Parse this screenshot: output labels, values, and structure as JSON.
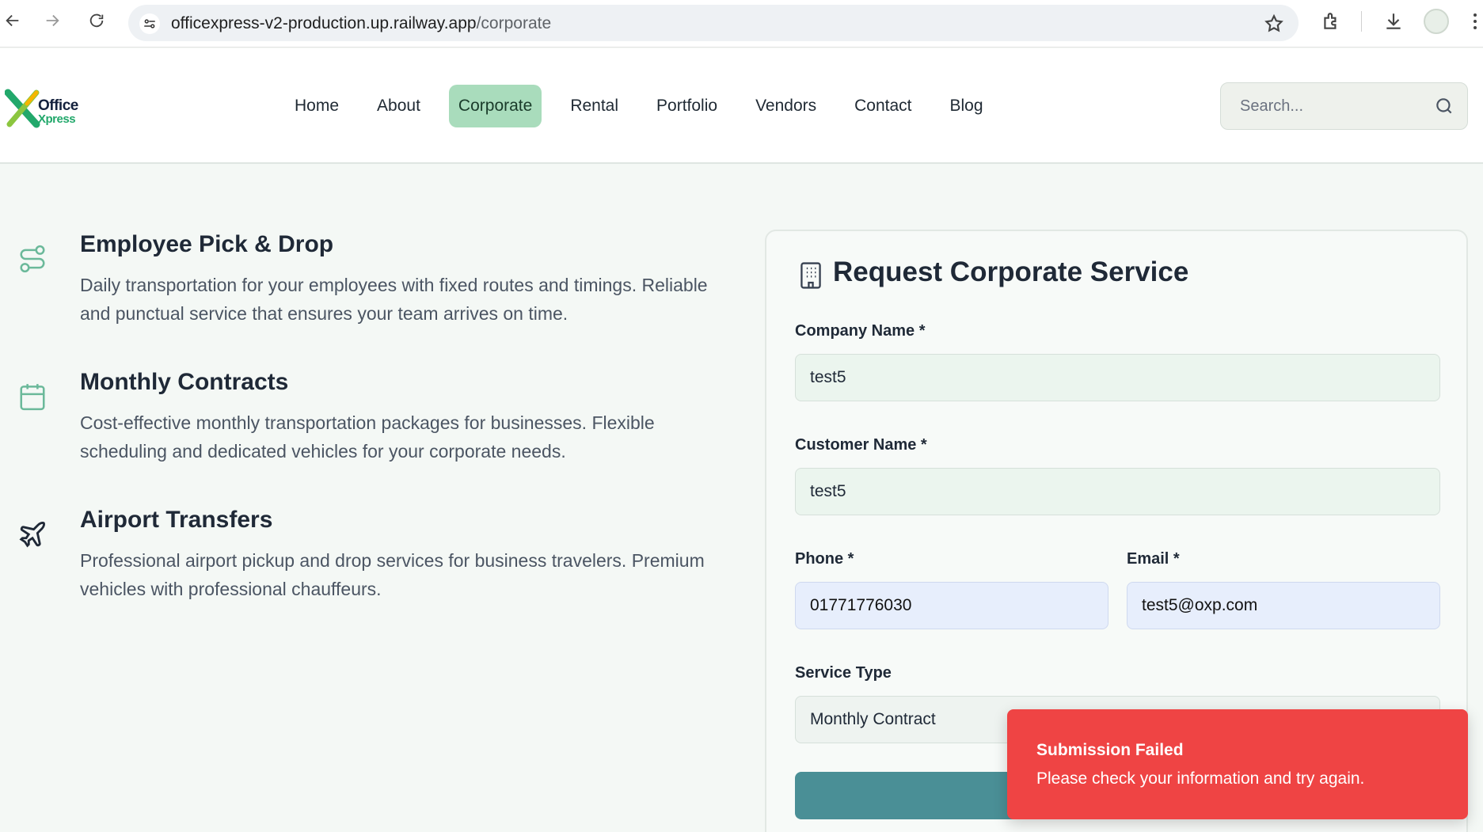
{
  "browser": {
    "url_host": "officexpress-v2-production.up.railway.app",
    "url_path": "/corporate"
  },
  "logo": {
    "line1": "Office",
    "line2": "Xpress"
  },
  "nav": {
    "items": [
      {
        "label": "Home",
        "active": false
      },
      {
        "label": "About",
        "active": false
      },
      {
        "label": "Corporate",
        "active": true
      },
      {
        "label": "Rental",
        "active": false
      },
      {
        "label": "Portfolio",
        "active": false
      },
      {
        "label": "Vendors",
        "active": false
      },
      {
        "label": "Contact",
        "active": false
      },
      {
        "label": "Blog",
        "active": false
      }
    ]
  },
  "search": {
    "placeholder": "Search..."
  },
  "features": [
    {
      "icon": "route-icon",
      "title": "Employee Pick & Drop",
      "description": "Daily transportation for your employees with fixed routes and timings. Reliable and punctual service that ensures your team arrives on time."
    },
    {
      "icon": "calendar-icon",
      "title": "Monthly Contracts",
      "description": "Cost-effective monthly transportation packages for businesses. Flexible scheduling and dedicated vehicles for your corporate needs."
    },
    {
      "icon": "plane-icon",
      "title": "Airport Transfers",
      "description": "Professional airport pickup and drop services for business travelers. Premium vehicles with professional chauffeurs."
    }
  ],
  "form": {
    "title": "Request Corporate Service",
    "company_label": "Company Name *",
    "company_value": "test5",
    "customer_label": "Customer Name *",
    "customer_value": "test5",
    "phone_label": "Phone *",
    "phone_value": "01771776030",
    "email_label": "Email *",
    "email_value": "test5@oxp.com",
    "service_label": "Service Type",
    "service_value": "Monthly Contract"
  },
  "toast": {
    "title": "Submission Failed",
    "message": "Please check your information and try again."
  },
  "colors": {
    "accent": "#a9dcbc",
    "submit": "#4a8f96",
    "toast": "#ef4444"
  }
}
